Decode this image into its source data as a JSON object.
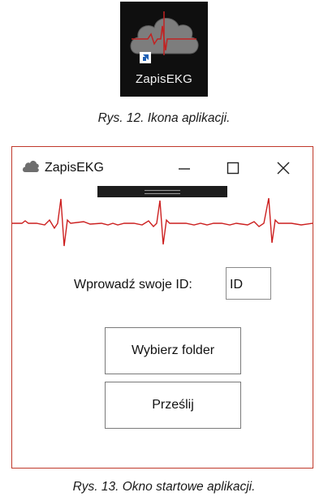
{
  "figure12": {
    "icon_label": "ZapisEKG",
    "icon": "cloud-ekg-icon",
    "overlay_icon": "shortcut-arrow-icon",
    "caption": "Rys. 12. Ikona aplikacji."
  },
  "figure13": {
    "window": {
      "title": "ZapisEKG",
      "app_icon": "cloud-icon",
      "controls": [
        "minimize-icon",
        "maximize-icon",
        "close-icon"
      ]
    },
    "ekg_color": "#cc1f1f",
    "id_label": "Wprowadź swoje ID:",
    "id_placeholder": "ID",
    "buttons": {
      "choose_folder": "Wybierz folder",
      "send": "Prześlij"
    },
    "caption": "Rys. 13. Okno startowe aplikacji."
  },
  "colors": {
    "window_border": "#c0392b",
    "icon_background": "#0f0f0f"
  }
}
